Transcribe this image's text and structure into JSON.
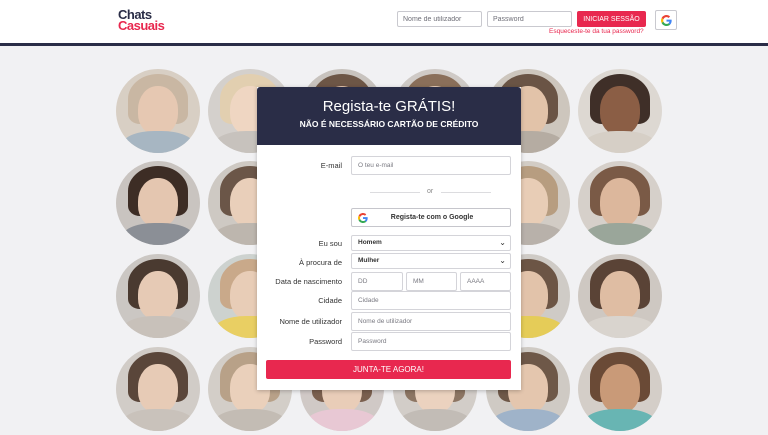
{
  "header": {
    "logo_line1": "Chats",
    "logo_line2": "Casuais",
    "username_placeholder": "Nome de utilizador",
    "password_placeholder": "Password",
    "login_label": "INICIAR SESSÃO",
    "forgot_label": "Esqueceste-te da tua password?",
    "google_icon": "google-icon"
  },
  "signup": {
    "title": "Regista-te GRÁTIS!",
    "subtitle": "NÃO É NECESSÁRIO CARTÃO DE CRÉDITO",
    "email_label": "E-mail",
    "email_placeholder": "O teu e-mail",
    "or_label": "or",
    "google_label": "Regista-te com o Google",
    "iam_label": "Eu sou",
    "iam_value": "Homem",
    "seeking_label": "À procura de",
    "seeking_value": "Mulher",
    "birth_label": "Data de nascimento",
    "day_placeholder": "DD",
    "month_placeholder": "MM",
    "year_placeholder": "AAAA",
    "city_label": "Cidade",
    "city_placeholder": "Cidade",
    "user_label": "Nome de utilizador",
    "user_placeholder": "Nome de utilizador",
    "pass_label": "Password",
    "pass_placeholder": "Password",
    "join_label": "JUNTA-TE AGORA!"
  },
  "colors": {
    "brand_red": "#e8284f",
    "navy": "#2a2d47"
  }
}
